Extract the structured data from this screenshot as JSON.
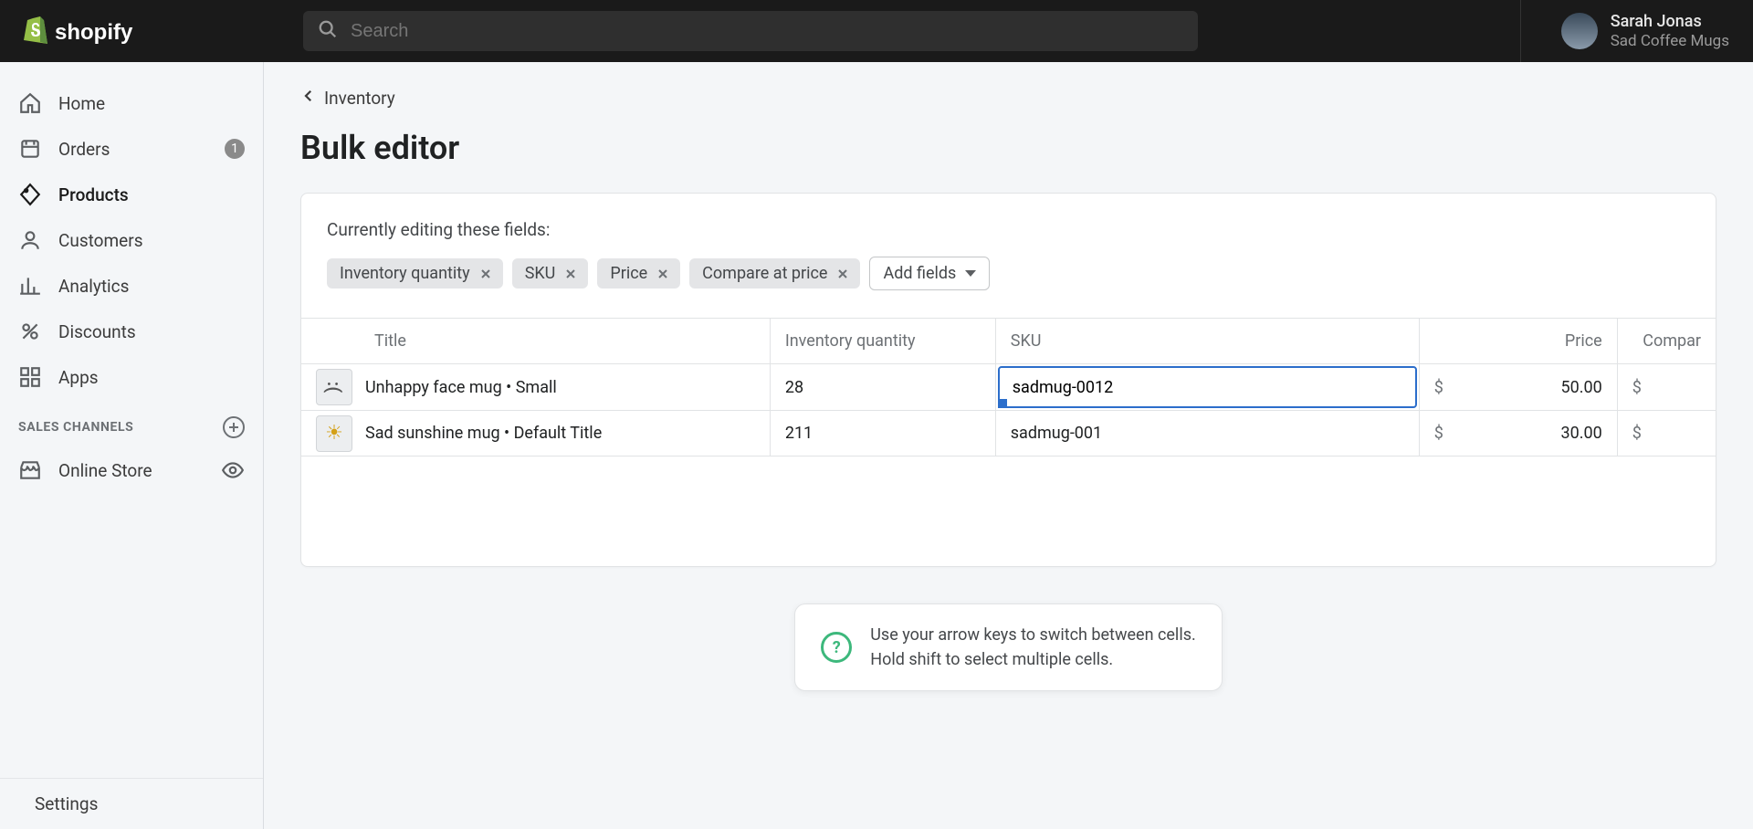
{
  "topbar": {
    "search_placeholder": "Search",
    "user_name": "Sarah Jonas",
    "user_store": "Sad Coffee Mugs"
  },
  "sidebar": {
    "items": [
      {
        "label": "Home"
      },
      {
        "label": "Orders",
        "badge": "1"
      },
      {
        "label": "Products"
      },
      {
        "label": "Customers"
      },
      {
        "label": "Analytics"
      },
      {
        "label": "Discounts"
      },
      {
        "label": "Apps"
      }
    ],
    "section_label": "SALES CHANNELS",
    "channel": "Online Store",
    "settings": "Settings"
  },
  "main": {
    "breadcrumb": "Inventory",
    "page_title": "Bulk editor",
    "editing_label": "Currently editing these fields:",
    "chips": [
      "Inventory quantity",
      "SKU",
      "Price",
      "Compare at price"
    ],
    "add_fields": "Add fields",
    "columns": {
      "title": "Title",
      "qty": "Inventory quantity",
      "sku": "SKU",
      "price": "Price",
      "compare": "Compar"
    },
    "currency": "$",
    "rows": [
      {
        "title": "Unhappy face mug • Small",
        "qty": "28",
        "sku": "sadmug-0012",
        "price": "50.00",
        "compare": ""
      },
      {
        "title": "Sad sunshine mug • Default Title",
        "qty": "211",
        "sku": "sadmug-001",
        "price": "30.00",
        "compare": ""
      }
    ],
    "hint_line1": "Use your arrow keys to switch between cells.",
    "hint_line2": "Hold shift to select multiple cells."
  }
}
